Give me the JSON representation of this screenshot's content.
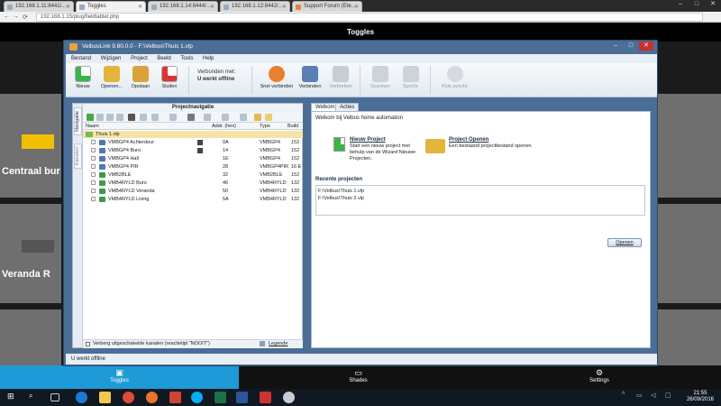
{
  "browser": {
    "tabs": [
      {
        "label": "192.168.1.11:8441/..."
      },
      {
        "label": "Toggles"
      },
      {
        "label": "192.168.1.14:8444/..."
      },
      {
        "label": "192.168.1.12:8442/..."
      },
      {
        "label": "Support Forum (Ete..."
      }
    ],
    "url": "192.168.1.15/plug/fieldtablet.php"
  },
  "app": {
    "title": "Toggles",
    "tiles": [
      {
        "label": "Centraal bur"
      },
      {
        "label": "Veranda R"
      }
    ],
    "accent": "#f0c000",
    "bottom_nav": [
      {
        "label": "Toggles",
        "icon": "toggles-icon"
      },
      {
        "label": "Shades",
        "icon": "shades-icon"
      },
      {
        "label": "Settings",
        "icon": "gear-icon"
      }
    ]
  },
  "velbus": {
    "title": "VelbusLink 9.80.0.0 - F:\\Velbus\\Thuis 1.vlp",
    "menu": [
      "Bestand",
      "Wijzigen",
      "Project",
      "Beeld",
      "Tools",
      "Help"
    ],
    "ribbon": {
      "nieuw": "Nieuw",
      "openen": "Openen...",
      "opslaan": "Opslaan",
      "sluiten": "Sluiten",
      "conn_label": "Verbonden met:",
      "conn_status": "U werkt offline",
      "snel": "Snel verbinden",
      "verbinden": "Verbinden",
      "verbreken": "Verbreken",
      "scannen": "Scannen",
      "synchr": "Synchr.",
      "klok": "Klok synchr."
    },
    "side_tabs": [
      "Navigatie",
      "Kanalen"
    ],
    "nav_title": "Projectnavigatie",
    "columns": {
      "naam": "Naam",
      "addr": "Addr. (hex)",
      "type": "Type",
      "build": "Build"
    },
    "root": "Thuis 1.vlp",
    "modules": [
      {
        "name": "VMBGP4 Achterdeur",
        "addr": "0A",
        "type": "VMBGP4",
        "build": "152",
        "kind": "gp"
      },
      {
        "name": "VMBGP4 Buro",
        "addr": "14",
        "type": "VMBGP4",
        "build": "152",
        "kind": "gp"
      },
      {
        "name": "VMBGP4 Hall",
        "addr": "1E",
        "type": "VMBGP4",
        "build": "152",
        "kind": "gp"
      },
      {
        "name": "VMBGP4 PIR",
        "addr": "28",
        "type": "VMBGP4PIR",
        "build": "16 E",
        "kind": "gp"
      },
      {
        "name": "VMB2BLE",
        "addr": "32",
        "type": "VMB2BLE",
        "build": "152",
        "kind": "ry"
      },
      {
        "name": "VMB4RYLD Buro",
        "addr": "46",
        "type": "VMB4RYLD",
        "build": "132",
        "kind": "ry"
      },
      {
        "name": "VMB4RYLD Veranda",
        "addr": "50",
        "type": "VMB4RYLD",
        "build": "132",
        "kind": "ry"
      },
      {
        "name": "VMB4RYLD Living",
        "addr": "5A",
        "type": "VMB4RYLD",
        "build": "132",
        "kind": "ry"
      }
    ],
    "footer_check": "Verberg uitgeschakelde kanalen (reactietijd \"NOOIT\")",
    "legend": "Legende",
    "tabs": [
      "Welkom",
      "Acties"
    ],
    "welcome": "Welkom bij Velbus home automation",
    "new_project": {
      "title": "Nieuw Project",
      "desc1": "Start een nieuw project met",
      "desc2": "behulp van de Wizard Nieuwe",
      "desc3": "Projecten."
    },
    "open_project": {
      "title": "Project Openen",
      "desc": "Een bestaand projectbestand openen."
    },
    "recent_title": "Recente projecten",
    "recent": [
      "F:\\Velbus\\Thuis 1.vlp",
      "F:\\Velbus\\Thuis 2.vlp"
    ],
    "open_button": "Openen",
    "status": "U werkt offline"
  },
  "taskbar": {
    "time": "21:55",
    "date": "26/09/2016"
  }
}
